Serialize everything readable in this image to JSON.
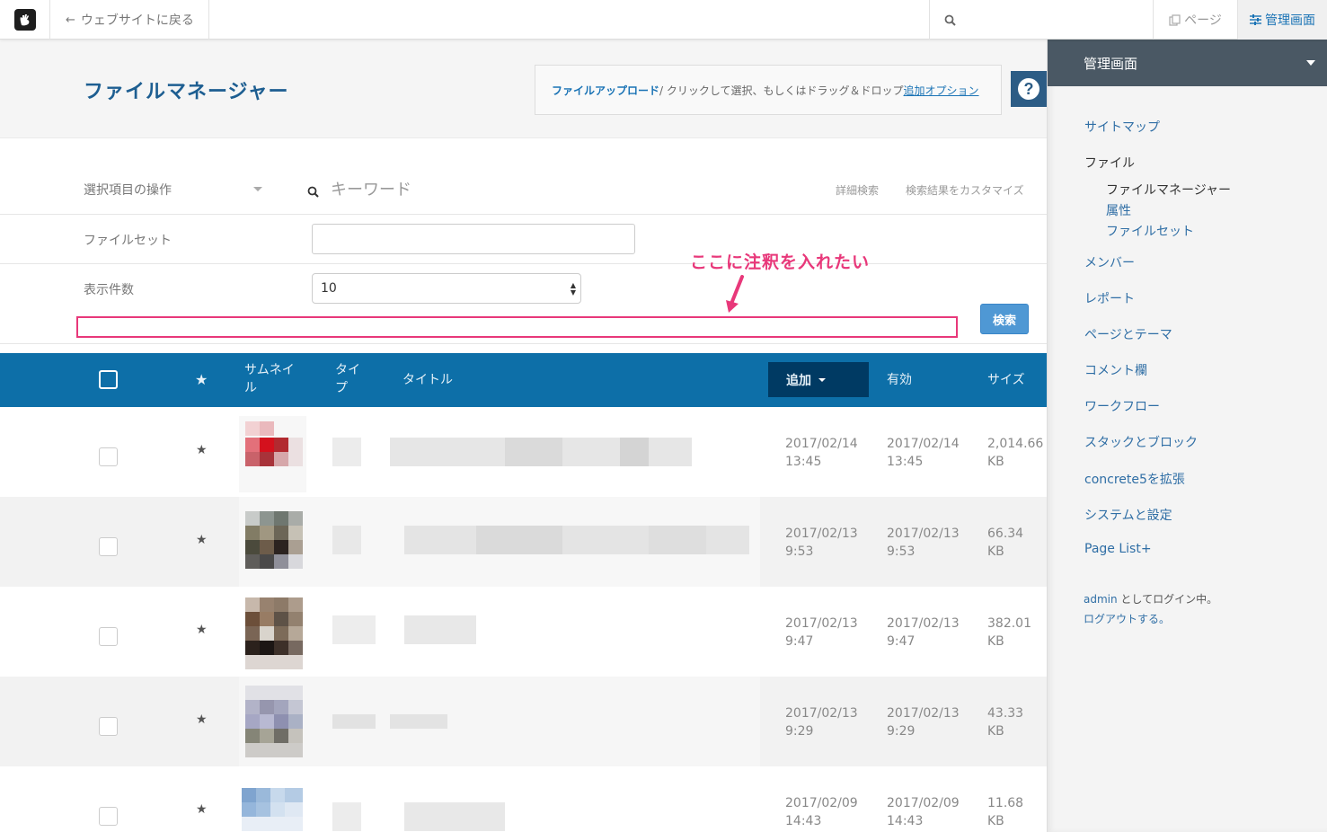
{
  "topbar": {
    "back_label": "ウェブサイトに戻る",
    "page_label": "ページ",
    "admin_label": "管理画面"
  },
  "header": {
    "title": "ファイルマネージャー",
    "upload_link": "ファイルアップロード",
    "upload_text": " / クリックして選択、もしくはドラッグ＆ドロップ ",
    "upload_options": "追加オプション"
  },
  "filters": {
    "bulk_label": "選択項目の操作",
    "keyword_placeholder": "キーワード",
    "advanced_search": "詳細検索",
    "customize_results": "検索結果をカスタマイズ",
    "fileset_label": "ファイルセット",
    "fileset_value": "",
    "count_label": "表示件数",
    "count_value": "10",
    "search_button": "検索"
  },
  "annotation": {
    "text": "ここに注釈を入れたい",
    "color": "#e8387a"
  },
  "table": {
    "headers": {
      "thumbnail": "サムネイル",
      "type": "タイプ",
      "title": "タイトル",
      "added": "追加",
      "valid": "有効",
      "size": "サイズ"
    },
    "rows": [
      {
        "added": [
          "2017/02/14",
          "13:45"
        ],
        "valid": [
          "2017/02/14",
          "13:45"
        ],
        "size": [
          "2,014.66",
          "KB"
        ]
      },
      {
        "added": [
          "2017/02/13",
          "9:53"
        ],
        "valid": [
          "2017/02/13",
          "9:53"
        ],
        "size": [
          "66.34",
          "KB"
        ]
      },
      {
        "added": [
          "2017/02/13",
          "9:47"
        ],
        "valid": [
          "2017/02/13",
          "9:47"
        ],
        "size": [
          "382.01",
          "KB"
        ]
      },
      {
        "added": [
          "2017/02/13",
          "9:29"
        ],
        "valid": [
          "2017/02/13",
          "9:29"
        ],
        "size": [
          "43.33",
          "KB"
        ]
      },
      {
        "added": [
          "2017/02/09",
          "14:43"
        ],
        "valid": [
          "2017/02/09",
          "14:43"
        ],
        "size": [
          "11.68",
          "KB"
        ]
      }
    ]
  },
  "sidebar": {
    "title": "管理画面",
    "items": {
      "sitemap": "サイトマップ",
      "files": "ファイル",
      "file_manager": "ファイルマネージャー",
      "attributes": "属性",
      "file_sets": "ファイルセット",
      "members": "メンバー",
      "reports": "レポート",
      "pages_themes": "ページとテーマ",
      "comments": "コメント欄",
      "workflow": "ワークフロー",
      "stacks_blocks": "スタックとブロック",
      "extend": "concrete5を拡張",
      "system": "システムと設定",
      "page_list": "Page List+"
    },
    "login_user": "admin",
    "login_text": " としてログイン中。",
    "logout": "ログアウトする。"
  },
  "colors": {
    "table_header": "#0d6fa8",
    "sort_active": "#003a63",
    "title_blue": "#1d5e91",
    "sidebar_head": "#4a5864",
    "button": "#4f98d4"
  }
}
